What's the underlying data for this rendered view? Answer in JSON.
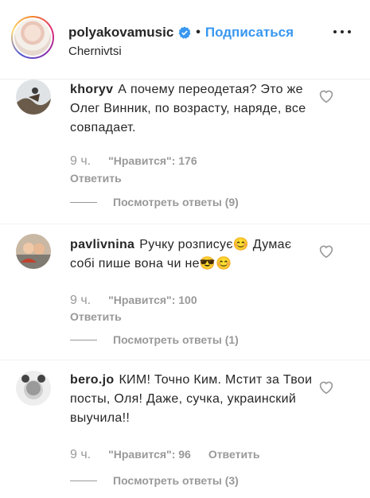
{
  "header": {
    "username": "polyakovamusic",
    "dot": "•",
    "follow_label": "Подписаться",
    "location": "Chernivtsi",
    "verified_icon": "verified-badge-icon",
    "more_icon": "more-options-icon",
    "accent_color": "#3897f0"
  },
  "comments": [
    {
      "username": "khoryv",
      "text": "А почему переодетая? Это же Олег Винник, по возрасту, наряде, все совпадает.",
      "time": "9 ч.",
      "likes": "\"Нравится\": 176",
      "reply_label": "Ответить",
      "view_replies": "Посмотреть ответы (9)"
    },
    {
      "username": "pavlivnina",
      "text": "Ручку розписує😊 Думає собі пише вона чи не😎😊",
      "time": "9 ч.",
      "likes": "\"Нравится\": 100",
      "reply_label": "Ответить",
      "view_replies": "Посмотреть ответы (1)"
    },
    {
      "username": "bero.jo",
      "text": "КИМ! Точно Ким. Мстит за Твои посты, Оля! Даже, сучка, украинский выучила!!",
      "time": "9 ч.",
      "likes": "\"Нравится\": 96",
      "reply_label": "Ответить",
      "view_replies": "Посмотреть ответы (3)"
    }
  ]
}
